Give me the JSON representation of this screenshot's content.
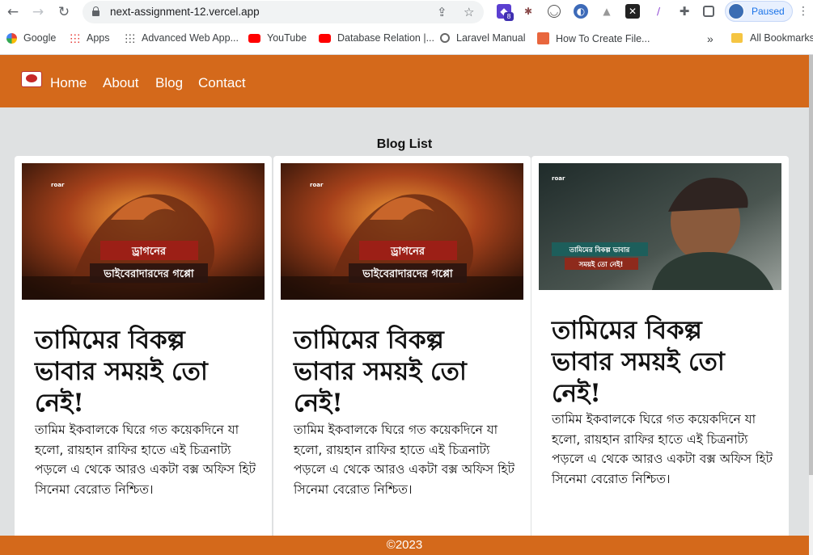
{
  "browser": {
    "url": "next-assignment-12.vercel.app",
    "profile_label": "Paused",
    "bookmarks": [
      {
        "label": "Google"
      },
      {
        "label": "Apps"
      },
      {
        "label": "Advanced Web App..."
      },
      {
        "label": "YouTube"
      },
      {
        "label": "Database Relation |..."
      },
      {
        "label": "Laravel Manual"
      },
      {
        "label": "How To Create File..."
      },
      {
        "label": "All Bookmarks"
      }
    ],
    "more_bookmarks": "»",
    "extension_badge": "8"
  },
  "site": {
    "nav": [
      "Home",
      "About",
      "Blog",
      "Contact"
    ],
    "list_title": "Blog List",
    "footer": "©2023",
    "cards": [
      {
        "image_caption_line1": "ড্রাগনের",
        "image_caption_line2": "ভাইবেরাদারদের গপ্পো",
        "image_brand": "roar",
        "title": "তামিমের বিকল্প ভাবার সময়ই তো নেই!",
        "body": "তামিম ইকবালকে ঘিরে গত কয়েকদিনে যা হলো, রায়হান রাফির হাতে এই চিত্রনাট্য পড়লে এ থেকে আরও একটা বক্স অফিস হিট সিনেমা বেরোত নিশ্চিত।"
      },
      {
        "image_caption_line1": "ড্রাগনের",
        "image_caption_line2": "ভাইবেরাদারদের গপ্পো",
        "image_brand": "roar",
        "title": "তামিমের বিকল্প ভাবার সময়ই তো নেই!",
        "body": "তামিম ইকবালকে ঘিরে গত কয়েকদিনে যা হলো, রায়হান রাফির হাতে এই চিত্রনাট্য পড়লে এ থেকে আরও একটা বক্স অফিস হিট সিনেমা বেরোত নিশ্চিত।"
      },
      {
        "image_caption_line1": "তামিমের বিকল্প ভাবার",
        "image_caption_line2": "সময়ই তো নেই!",
        "image_brand": "roar",
        "title": "তামিমের বিকল্প ভাবার সময়ই তো নেই!",
        "body": "তামিম ইকবালকে ঘিরে গত কয়েকদিনে যা হলো, রায়হান রাফির হাতে এই চিত্রনাট্য পড়লে এ থেকে আরও একটা বক্স অফিস হিট সিনেমা বেরোত নিশ্চিত।"
      }
    ]
  },
  "colors": {
    "header": "#d4691b",
    "page_bg": "#dfe1e2"
  }
}
